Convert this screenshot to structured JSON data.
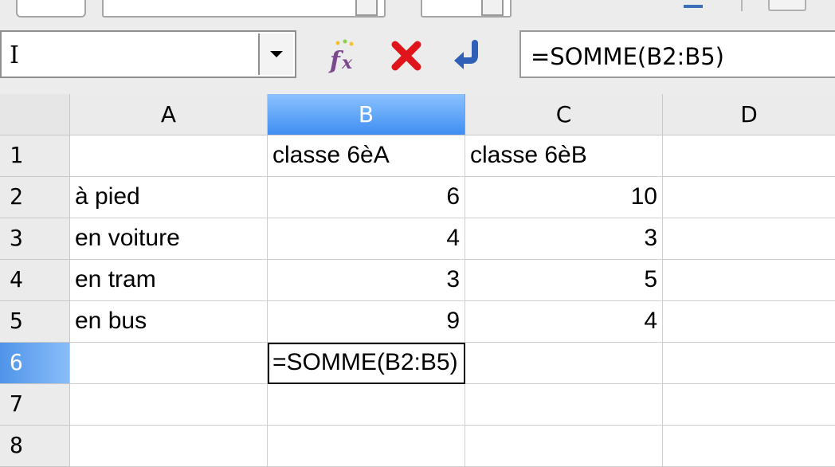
{
  "name_box": {
    "value": "I"
  },
  "formula_bar": {
    "formula": "=SOMME(B2:B5)"
  },
  "columns": [
    "A",
    "B",
    "C",
    "D"
  ],
  "rows": [
    "1",
    "2",
    "3",
    "4",
    "5",
    "6",
    "7",
    "8"
  ],
  "cells": {
    "B1": "classe 6èA",
    "C1": "classe 6èB",
    "A2": "à pied",
    "B2": "6",
    "C2": "10",
    "A3": "en voiture",
    "B3": "4",
    "C3": "3",
    "A4": "en tram",
    "B4": "3",
    "C4": "5",
    "A5": "en bus",
    "B5": "9",
    "C5": "4",
    "B6": "=SOMME(B2:B5)"
  },
  "selection": {
    "active_column": "B",
    "active_row": "6"
  },
  "colors": {
    "active_header": "#3e8ef2",
    "cancel_red": "#e0151c",
    "accept_blue": "#2f5fb6",
    "fx_purple": "#7b4a8e"
  },
  "icons": [
    "function-wizard-icon",
    "cancel-icon",
    "accept-icon",
    "dropdown-arrow-icon"
  ]
}
